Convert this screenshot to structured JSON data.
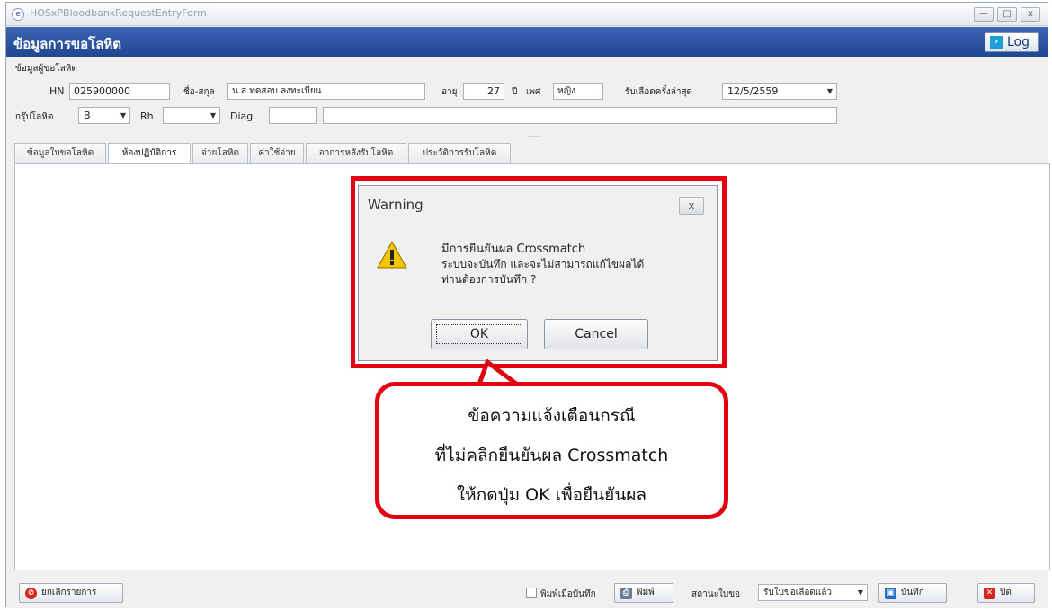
{
  "window": {
    "title": "HOSxPBloodbankRequestEntryForm",
    "controls": [
      "—",
      "□",
      "x"
    ]
  },
  "header": {
    "title": "ข้อมูลการขอโลหิต",
    "log_label": "Log"
  },
  "patient": {
    "section_label": "ข้อมูลผู้ขอโลหิต",
    "hn_label": "HN",
    "hn_value": "025900000",
    "name_label": "ชื่อ-สกุล",
    "name_value": "น.ส.ทดสอบ ลงทะเบียน",
    "age_label": "อายุ",
    "age_value": "27",
    "age_unit": "ปี",
    "sex_label": "เพศ",
    "sex_value": "หญิง",
    "last_blood_label": "รับเลือดครั้งล่าสุด",
    "last_blood_value": "12/5/2559",
    "blood_group_label": "กรุ๊ปโลหิต",
    "blood_group_value": "B",
    "rh_label": "Rh",
    "rh_value": "",
    "diag_label": "Diag",
    "diag_code": "",
    "diag_text": ""
  },
  "tabs": [
    {
      "label": "ข้อมูลใบขอโลหิต",
      "active": false
    },
    {
      "label": "ห้องปฏิบัติการ",
      "active": true
    },
    {
      "label": "จ่ายโลหิต",
      "active": false
    },
    {
      "label": "ค่าใช้จ่าย",
      "active": false
    },
    {
      "label": "อาการหลังรับโลหิต",
      "active": false
    },
    {
      "label": "ประวัติการรับโลหิต",
      "active": false
    }
  ],
  "dialog": {
    "title": "Warning",
    "close_label": "x",
    "message_lines": [
      "มีการยืนยันผล Crossmatch",
      "ระบบจะบันทึก และจะไม่สามารถแก้ไขผลได้",
      "ท่านต้องการบันทึก ?"
    ],
    "ok_label": "OK",
    "cancel_label": "Cancel"
  },
  "callout": {
    "lines": [
      "ข้อความแจ้งเตือนกรณี",
      "ที่ไม่คลิกยืนยันผล Crossmatch",
      "ให้กดปุ่ม OK เพื่อยืนยันผล"
    ]
  },
  "bottom": {
    "cancel_list_label": "ยกเลิกรายการ",
    "print_on_save_label": "พิมพ์เมื่อบันทึก",
    "print_label": "พิมพ์",
    "status_label": "สถานะใบขอ",
    "status_value": "รับใบขอเลือดแล้ว",
    "save_label": "บันทึก",
    "close_label": "ปิด"
  },
  "colors": {
    "header": "#2a519f",
    "highlight": "#e3000f"
  }
}
